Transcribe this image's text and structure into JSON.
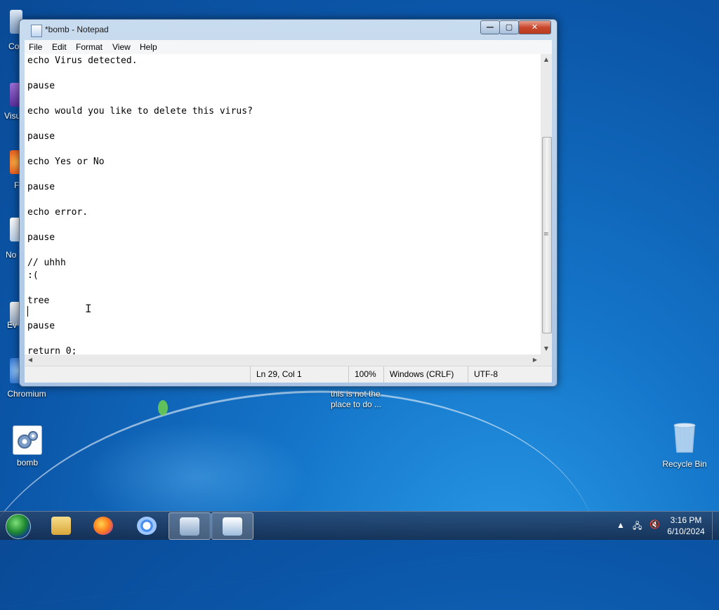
{
  "window": {
    "title": "*bomb - Notepad",
    "controls": {
      "minimize": "—",
      "maximize": "▢",
      "close": "✕"
    }
  },
  "menu": [
    "File",
    "Edit",
    "Format",
    "View",
    "Help"
  ],
  "editor": {
    "text": "echo Virus detected.\n\npause\n\necho would you like to delete this virus?\n\npause\n\necho Yes or No\n\npause\n\necho error.\n\npause\n\n// uhhh\n:(\n\ntree\n\npause\n\nreturn 0;"
  },
  "status": {
    "position": "Ln 29, Col 1",
    "zoom": "100%",
    "line_endings": "Windows (CRLF)",
    "encoding": "UTF-8"
  },
  "desktop": {
    "partial_labels": [
      "Co",
      "Visu",
      "F",
      "No",
      "Ev"
    ],
    "chromium_label": "Chromium",
    "note_label_line1": "this is not the",
    "note_label_line2": "place to do ...",
    "bomb_label": "bomb",
    "recycle_label": "Recycle Bin"
  },
  "taskbar": {
    "icons": [
      "windows-start-icon",
      "file-explorer-icon",
      "firefox-icon",
      "chromium-icon",
      "control-panel-icon",
      "notepad-icon"
    ],
    "time": "3:16 PM",
    "date": "6/10/2024"
  },
  "colors": {
    "desktop_blue": "#0b56a8",
    "window_frame": "#a9c4e4",
    "close_red": "#c8482d"
  }
}
